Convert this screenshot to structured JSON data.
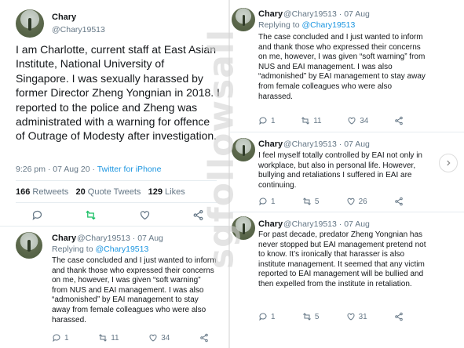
{
  "main_tweet": {
    "name": "Chary",
    "handle": "@Chary19513",
    "text": "I am Charlotte, current staff at East Asian Institute, National University of Singapore. I was sexually harassed by former Director Zheng Yongnian in 2018. I reported to the police and Zheng was administrated with a warning for offence of Outrage of Modesty after investigation.",
    "timestamp": "9:26 pm · 07 Aug 20 · ",
    "source": "Twitter for iPhone",
    "retweets_count": "166",
    "retweets_label": "Retweets",
    "quote_count": "20",
    "quote_label": "Quote Tweets",
    "likes_count": "129",
    "likes_label": "Likes"
  },
  "reply_left": {
    "name": "Chary",
    "handle_date": "@Chary19513 · 07 Aug",
    "replying_prefix": "Replying to ",
    "replying_to": "@Chary19513",
    "text": "The case concluded and I just wanted to inform and thank those who expressed their concerns on me, however, I was given “soft warning” from NUS and EAI management. I was also “admonished” by EAI management to stay away from female colleagues who were also harassed.",
    "replies": "1",
    "retweets": "11",
    "likes": "34"
  },
  "right_tweets": [
    {
      "name": "Chary",
      "handle_date": "@Chary19513 · 07 Aug",
      "replying_prefix": "Replying to ",
      "replying_to": "@Chary19513",
      "text": "The case concluded and I just wanted to inform and thank those who expressed their concerns on me, however, I was given “soft warning” from NUS and EAI management. I was also “admonished” by EAI management to stay away from female colleagues who were also harassed.",
      "replies": "1",
      "retweets": "11",
      "likes": "34"
    },
    {
      "name": "Chary",
      "handle_date": "@Chary19513 · 07 Aug",
      "text": "I feel myself totally controlled by EAI not only in workplace, but also in personal life. However, bullying and retaliations I suffered in EAI are continuing.",
      "replies": "1",
      "retweets": "5",
      "likes": "26"
    },
    {
      "name": "Chary",
      "handle_date": "@Chary19513 · 07 Aug",
      "text": "For past decade, predator Zheng Yongnian has never stopped but EAI management pretend not to know. It’s ironically that harasser is also institute management. It seemed that any victim reported to EAI management will be bullied and then expelled from the institute in retaliation.",
      "replies": "1",
      "retweets": "5",
      "likes": "31"
    }
  ],
  "watermark": "sgfollowsall",
  "icons": {
    "reply": "reply-icon",
    "retweet": "retweet-icon",
    "like": "heart-icon",
    "share": "share-icon",
    "next": "chevron-right-icon"
  },
  "colors": {
    "link": "#1b95e0",
    "retweet_green": "#17bf63",
    "muted": "#657786"
  }
}
